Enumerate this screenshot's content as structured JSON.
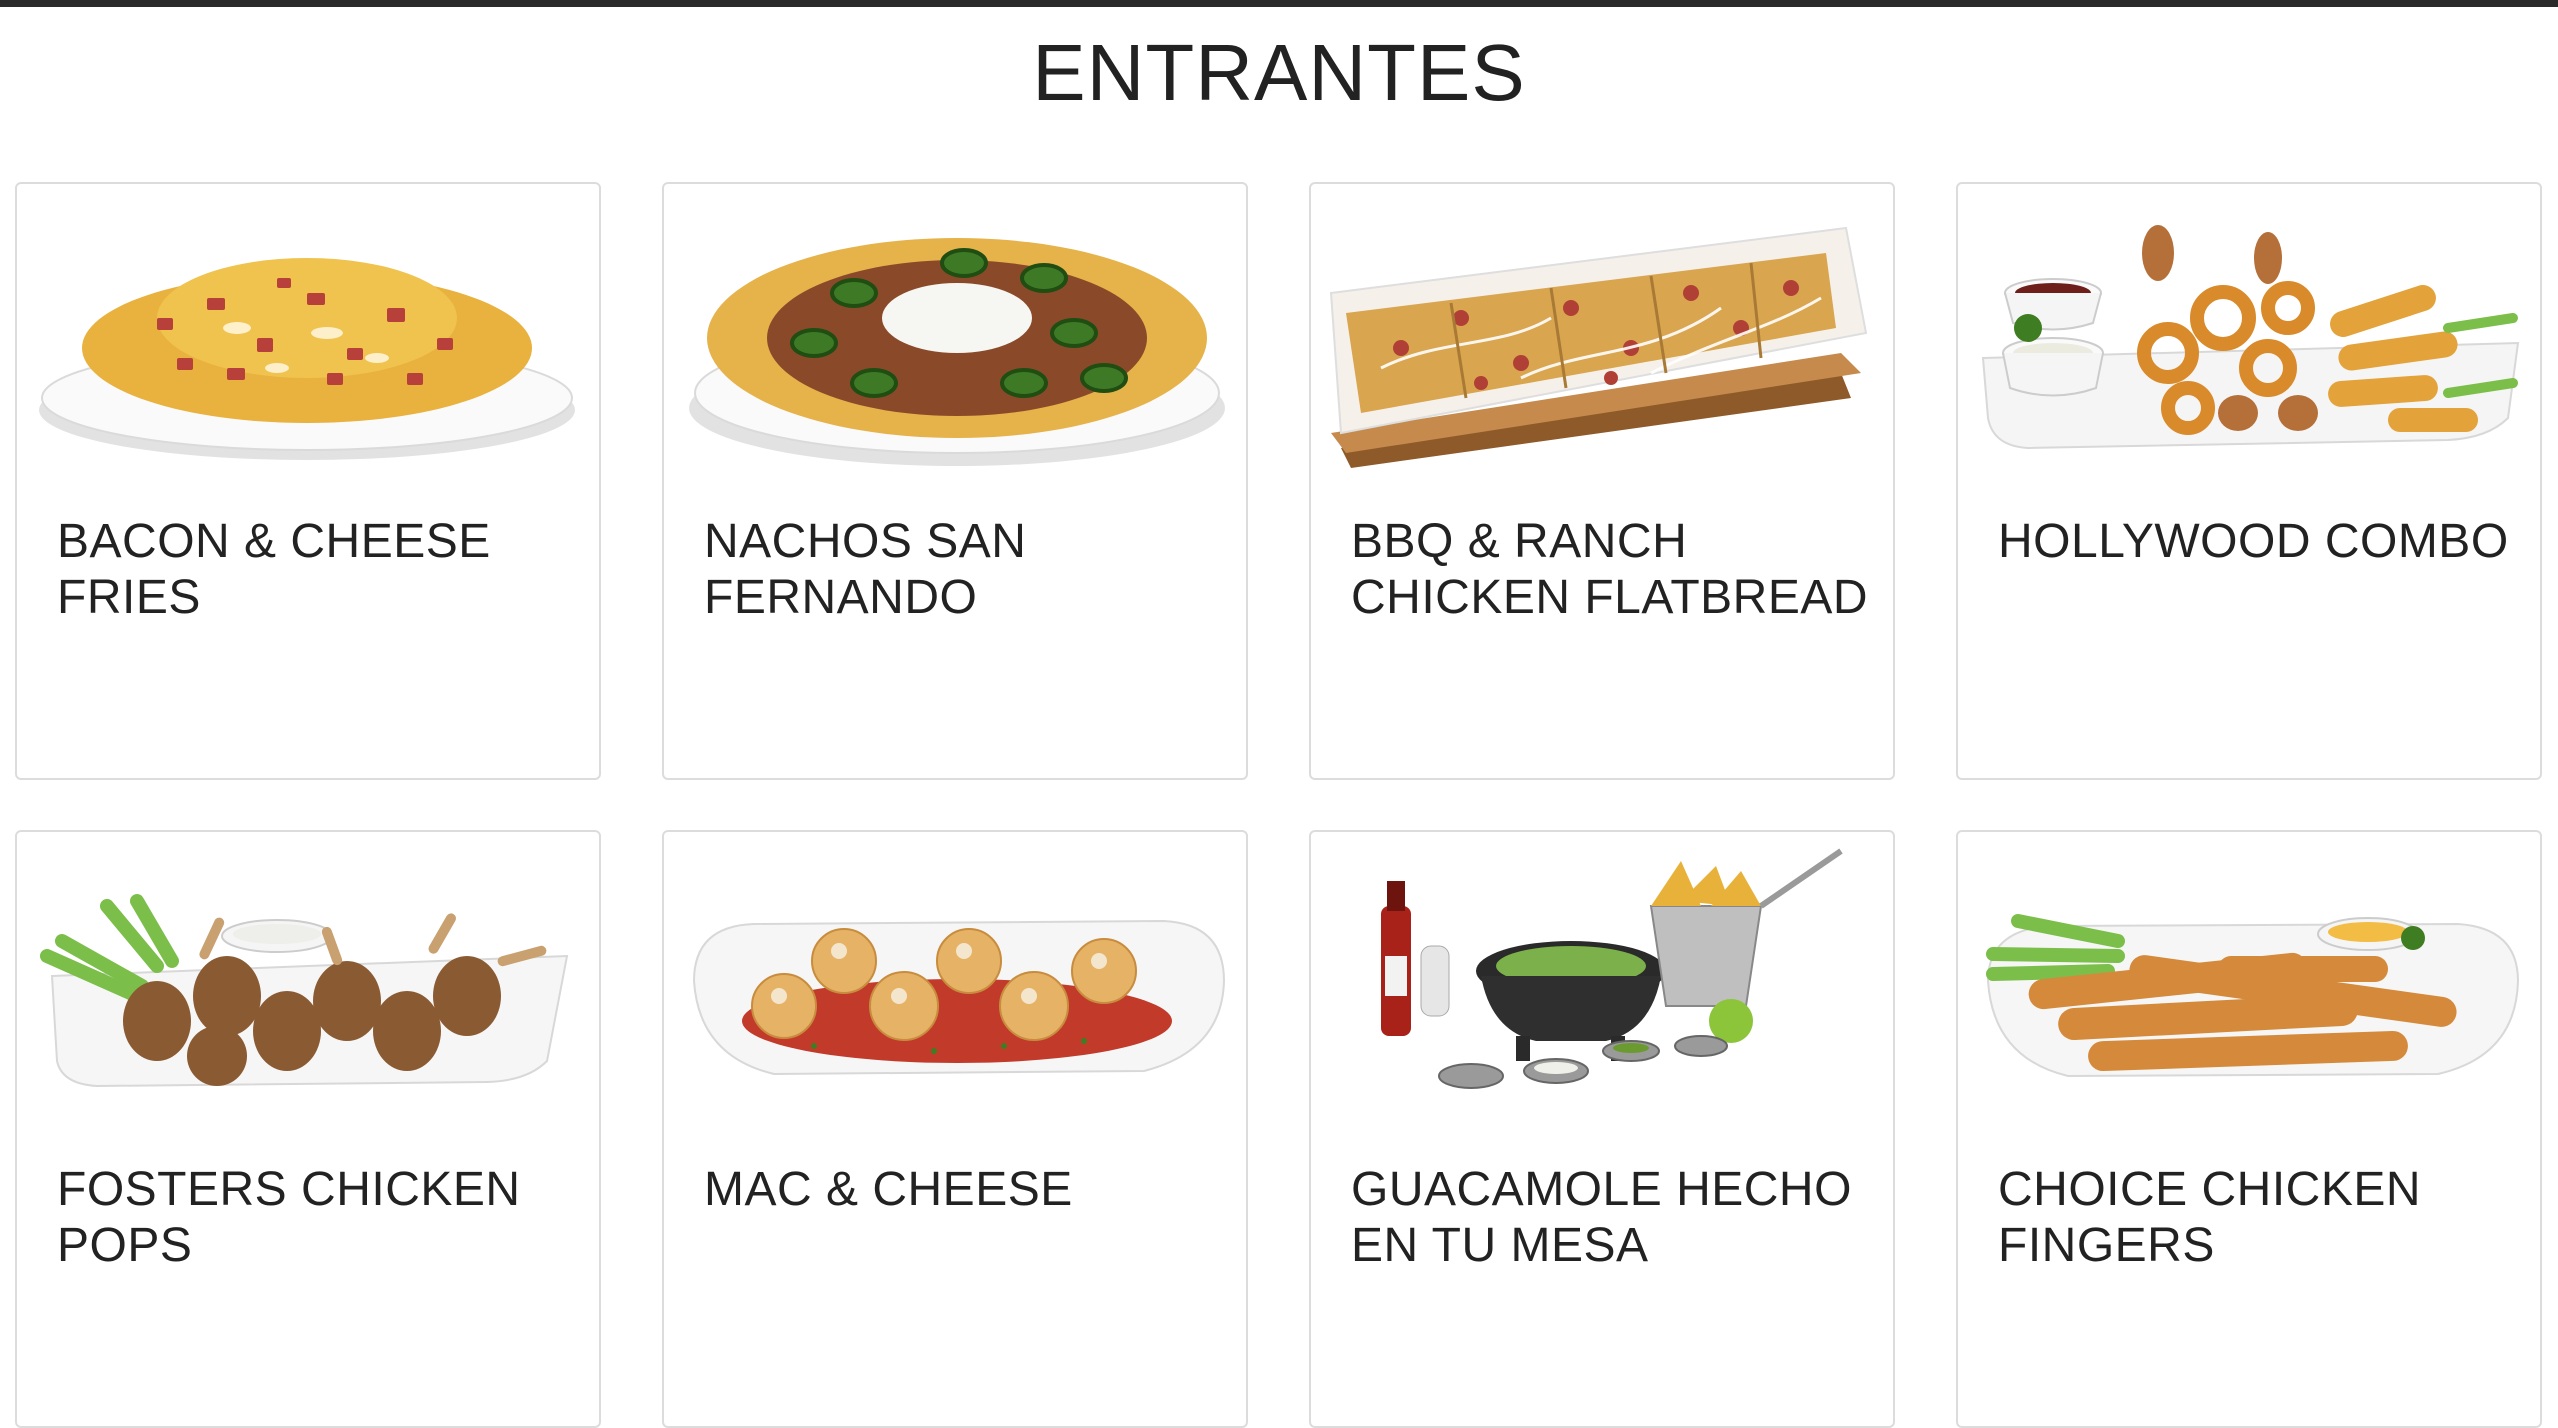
{
  "section": {
    "title": "ENTRANTES"
  },
  "items": [
    {
      "name": "BACON & CHEESE FRIES",
      "dish": "bacon-cheese-fries"
    },
    {
      "name": "NACHOS SAN FERNANDO",
      "dish": "nachos"
    },
    {
      "name": "BBQ & RANCH CHICKEN FLATBREAD",
      "dish": "flatbread"
    },
    {
      "name": "HOLLYWOOD COMBO",
      "dish": "combo"
    },
    {
      "name": "FOSTERS CHICKEN POPS",
      "dish": "chicken-pops"
    },
    {
      "name": "MAC & CHEESE",
      "dish": "mac-cheese"
    },
    {
      "name": "GUACAMOLE HECHO EN TU MESA",
      "dish": "guacamole"
    },
    {
      "name": "CHOICE CHICKEN FINGERS",
      "dish": "chicken-fingers"
    }
  ],
  "colors": {
    "topbar": "#2a2a2a",
    "card_border": "#dcdcdc",
    "text": "#222222"
  }
}
